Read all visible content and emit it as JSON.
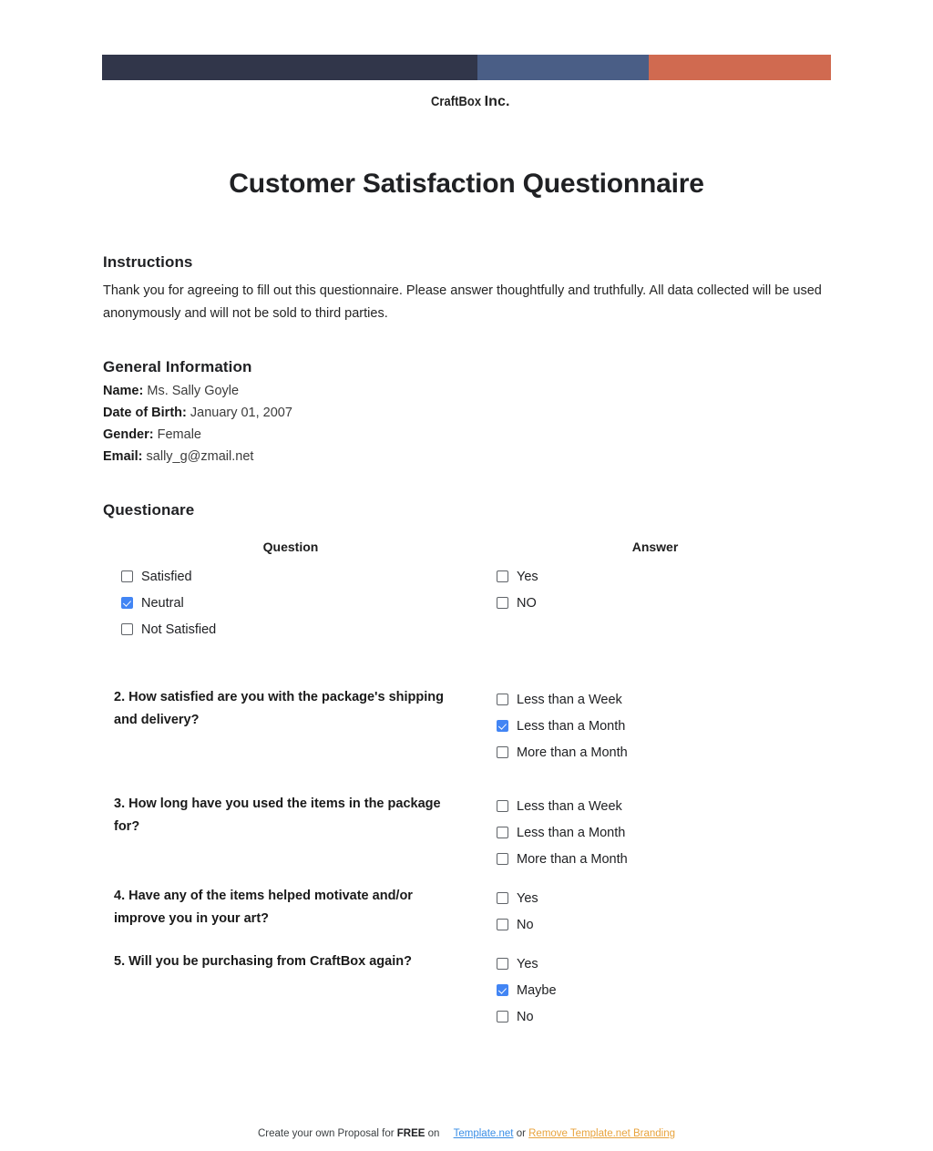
{
  "brand": {
    "company_name": "CraftBox",
    "company_suffix": "Inc.",
    "bar_colors": {
      "dark": "#31364a",
      "blue": "#4a5e86",
      "orange": "#d06a50"
    }
  },
  "document": {
    "title": "Customer Satisfaction Questionnaire"
  },
  "instructions": {
    "heading": "Instructions",
    "body": "Thank you for agreeing to fill out this questionnaire. Please answer thoughtfully and truthfully. All data collected will be used anonymously and will not be sold to third parties."
  },
  "general_information": {
    "heading": "General Information",
    "fields": [
      {
        "label": "Name:",
        "value": "Ms. Sally Goyle"
      },
      {
        "label": "Date of Birth:",
        "value": "January 01, 2007"
      },
      {
        "label": "Gender:",
        "value": "Female"
      },
      {
        "label": "Email:",
        "value": "sally_g@zmail.net"
      }
    ]
  },
  "questionnaire": {
    "heading": "Questionare",
    "columns": {
      "question": "Question",
      "answer": "Answer"
    },
    "rows": [
      {
        "question": "",
        "question_options": [
          {
            "label": "Satisfied",
            "checked": false
          },
          {
            "label": "Neutral",
            "checked": true
          },
          {
            "label": "Not Satisfied",
            "checked": false
          }
        ],
        "answer_options": [
          {
            "label": "Yes",
            "checked": false
          },
          {
            "label": "NO",
            "checked": false
          }
        ]
      },
      {
        "question": "2. How satisfied are you with the package's shipping and delivery?",
        "question_options": [],
        "answer_options": [
          {
            "label": "Less than a Week",
            "checked": false
          },
          {
            "label": "Less than a Month",
            "checked": true
          },
          {
            "label": "More than a Month",
            "checked": false
          }
        ]
      },
      {
        "question": "3. How long have you used the items in the package for?",
        "question_options": [],
        "answer_options": [
          {
            "label": "Less than a Week",
            "checked": false
          },
          {
            "label": "Less than a Month",
            "checked": false
          },
          {
            "label": "More than a Month",
            "checked": false
          }
        ]
      },
      {
        "question": "4. Have any of the items helped motivate and/or improve you in your art?",
        "question_options": [],
        "answer_options": [
          {
            "label": "Yes",
            "checked": false
          },
          {
            "label": "No",
            "checked": false
          }
        ]
      },
      {
        "question": "5. Will you be purchasing from CraftBox again?",
        "question_options": [],
        "answer_options": [
          {
            "label": "Yes",
            "checked": false
          },
          {
            "label": "Maybe",
            "checked": true
          },
          {
            "label": "No",
            "checked": false
          }
        ]
      }
    ]
  },
  "footer": {
    "prefix": "Create your own Proposal for",
    "free": "FREE",
    "on": "on",
    "link_primary": "Template.net",
    "separator": "or",
    "link_secondary": "Remove Template.net Branding",
    "link_primary_color": "#3a8ee6",
    "link_secondary_color": "#e8a33d"
  }
}
